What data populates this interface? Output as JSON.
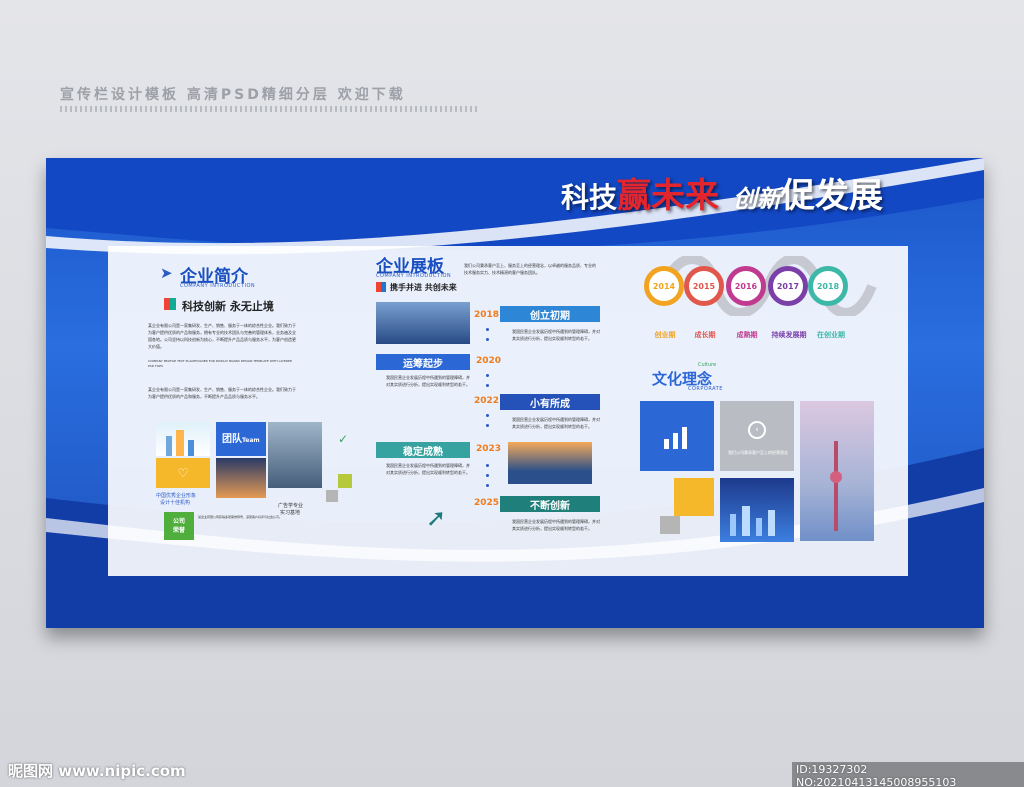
{
  "header": {
    "title": "宣传栏设计模板 高清PSD精细分层 欢迎下载"
  },
  "slogan": {
    "part1": "科技",
    "part2": "赢未来",
    "part3": "创新",
    "part4": "促发展"
  },
  "intro": {
    "title": "企业简介",
    "title_en": "COMPANY INTRODUCTION",
    "subtitle": "科技创新 永无止境",
    "body1": "某企业有限公司是一家集研发、生产、销售、服务于一体的综合性企业。我们致力于为客户提供优质的产品和服务，拥有专业的技术团队与完善的管理体系，业务遍及全国各地。公司坚持以科技创新为核心，不断提升产品品质与服务水平，为客户创造更大价值。",
    "body2": "COMPANY PROFILE TEXT PLACEHOLDER FOR DISPLAY BOARD DESIGN TEMPLATE WITH LAYERED PSD FILES",
    "body3": "某企业有限公司是一家集研发、生产、销售、服务于一体的综合性企业。我们致力于为客户提供优质的产品和服务，不断提升产品品质与服务水平。",
    "team_label": "团队",
    "team_en": "Team",
    "brand_caption1": "中国优秀企业形象",
    "brand_caption2": "设计十佳机构",
    "ad_caption1": "广告学专业",
    "ad_caption2": "实习基地",
    "honor_label1": "公司",
    "honor_label2": "荣誉",
    "honor_text": "某企业有限公司获得多项荣誉称号，深受客户好评与社会认可。"
  },
  "exhibit": {
    "title": "企业展板",
    "title_en": "COMPANY INTRODUCTION",
    "subtitle": "携手并进 共创未来",
    "intro_text": "我们公司秉承客户至上、服务至上的经营理念，以卓越的服务品质、专业的技术服务实力、技术精湛的客户服务团队。",
    "milestones": [
      {
        "year": "2018",
        "label": "创立初期"
      },
      {
        "year": "2020",
        "label": "运筹起步"
      },
      {
        "year": "2022",
        "label": "小有所成"
      },
      {
        "year": "2023",
        "label": "稳定成熟"
      },
      {
        "year": "2025",
        "label": "不断创新"
      }
    ],
    "milestone_text": "我国民营企业发展历程中所遇到的管理障碍，并对其实质进行分析，提出实现顺利转型的若干。"
  },
  "timeline": {
    "years": [
      "2014",
      "2015",
      "2016",
      "2017",
      "2018"
    ],
    "stages": [
      "创业期",
      "成长期",
      "成熟期",
      "持续发展期",
      "在创业期"
    ],
    "colors": [
      "#f2a420",
      "#e2574c",
      "#c03b8f",
      "#7b3fa8",
      "#3db8a8"
    ]
  },
  "culture": {
    "title": "文化理念",
    "title_en": "Culture",
    "corporate_en": "CORPORATE",
    "caption": "我们公司秉承客户至上的经营理念"
  },
  "watermark": {
    "left": "昵图网 www.nipic.com",
    "right": "ID:19327302 NO:20210413145008955103"
  }
}
